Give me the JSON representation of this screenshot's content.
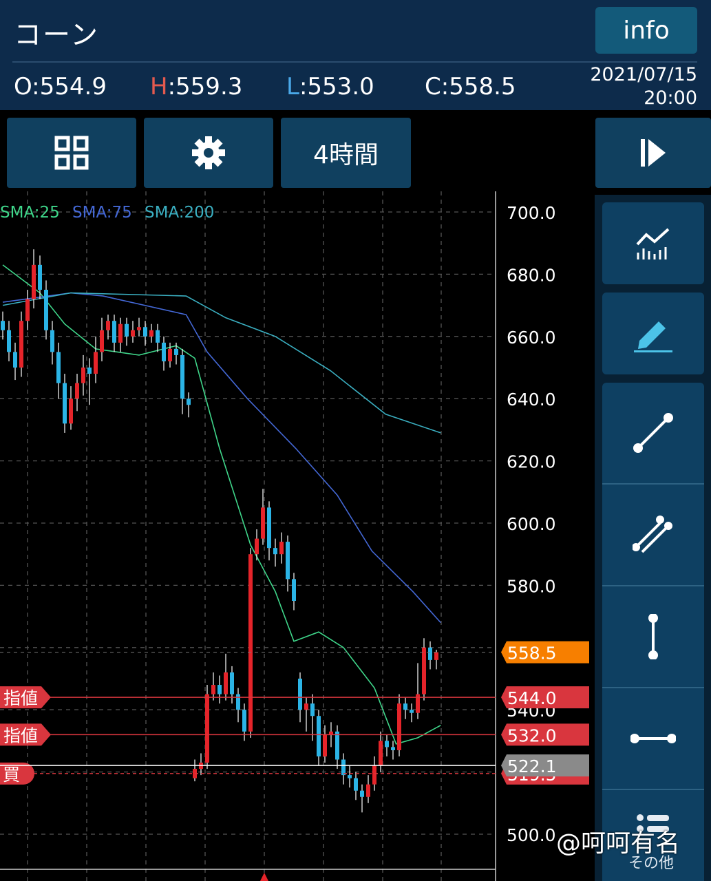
{
  "header": {
    "title": "コーン",
    "info_label": "info",
    "open": {
      "key": "O",
      "value": "554.9"
    },
    "high": {
      "key": "H",
      "value": "559.3"
    },
    "low": {
      "key": "L",
      "value": "553.0"
    },
    "close": {
      "key": "C",
      "value": "558.5"
    },
    "date": "2021/07/15",
    "time": "20:00"
  },
  "toolbar": {
    "layout_icon": "grid-icon",
    "settings_icon": "gear-icon",
    "timeframe_label": "4時間",
    "play_icon": "step-forward-icon"
  },
  "sidebar": {
    "tools": [
      "indicator-chart-icon",
      "pencil-icon",
      "trendline-icon",
      "parallel-lines-icon",
      "vertical-line-icon",
      "horizontal-line-icon",
      "menu-icon"
    ],
    "other_label": "その他"
  },
  "watermark": "@呵呵有名",
  "chart_data": {
    "type": "candlestick",
    "legend": [
      "SMA:25",
      "SMA:75",
      "SMA:200"
    ],
    "colors": {
      "up": "#e5242a",
      "down": "#2bb4e6",
      "sma25": "#3fd68a",
      "sma75": "#4468d6",
      "sma200": "#3aaec0",
      "current": "#f77f00",
      "order": "#d9363e",
      "position": "#8a8a8a"
    },
    "ylim": [
      490,
      710
    ],
    "y_ticks": [
      "700.0",
      "680.0",
      "660.0",
      "640.0",
      "620.0",
      "600.0",
      "580.0",
      "560.0",
      "540.0",
      "520.0",
      "500.0"
    ],
    "candles": [
      [
        665,
        668,
        659,
        662
      ],
      [
        662,
        665,
        652,
        655
      ],
      [
        655,
        658,
        646,
        650
      ],
      [
        650,
        668,
        647,
        665
      ],
      [
        665,
        675,
        662,
        672
      ],
      [
        672,
        688,
        669,
        683
      ],
      [
        683,
        686,
        672,
        675
      ],
      [
        675,
        678,
        659,
        662
      ],
      [
        662,
        665,
        651,
        655
      ],
      [
        655,
        658,
        640,
        645
      ],
      [
        645,
        648,
        629,
        632
      ],
      [
        632,
        644,
        630,
        640
      ],
      [
        640,
        648,
        636,
        645
      ],
      [
        645,
        654,
        641,
        650
      ],
      [
        650,
        653,
        638,
        648
      ],
      [
        648,
        660,
        645,
        655
      ],
      [
        655,
        666,
        652,
        662
      ],
      [
        662,
        667,
        659,
        665
      ],
      [
        665,
        667,
        655,
        658
      ],
      [
        658,
        666,
        655,
        664
      ],
      [
        664,
        666,
        657,
        660
      ],
      [
        660,
        665,
        658,
        662
      ],
      [
        662,
        666,
        660,
        663
      ],
      [
        663,
        665,
        657,
        660
      ],
      [
        660,
        664,
        658,
        662
      ],
      [
        662,
        664,
        655,
        658
      ],
      [
        658,
        660,
        649,
        652
      ],
      [
        652,
        658,
        650,
        656
      ],
      [
        656,
        658,
        651,
        654
      ],
      [
        654,
        656,
        635,
        640
      ],
      [
        640,
        642,
        634,
        638
      ],
      [
        518,
        524,
        517,
        521
      ],
      [
        521,
        526,
        519,
        523
      ],
      [
        523,
        548,
        521,
        545
      ],
      [
        545,
        552,
        543,
        548
      ],
      [
        548,
        551,
        542,
        545
      ],
      [
        545,
        558,
        543,
        552
      ],
      [
        552,
        554,
        542,
        545
      ],
      [
        545,
        547,
        536,
        540
      ],
      [
        540,
        542,
        530,
        533
      ],
      [
        533,
        592,
        531,
        590
      ],
      [
        590,
        598,
        588,
        595
      ],
      [
        595,
        611,
        593,
        605
      ],
      [
        605,
        607,
        588,
        592
      ],
      [
        592,
        595,
        586,
        590
      ],
      [
        590,
        597,
        587,
        594
      ],
      [
        594,
        596,
        578,
        582
      ],
      [
        582,
        584,
        572,
        575
      ],
      [
        550,
        552,
        536,
        540
      ],
      [
        540,
        544,
        533,
        542
      ],
      [
        542,
        545,
        530,
        538
      ],
      [
        538,
        540,
        522,
        525
      ],
      [
        525,
        535,
        523,
        532
      ],
      [
        532,
        536,
        528,
        533
      ],
      [
        533,
        535,
        521,
        524
      ],
      [
        524,
        526,
        516,
        519
      ],
      [
        519,
        522,
        515,
        518
      ],
      [
        518,
        520,
        511,
        514
      ],
      [
        514,
        516,
        507,
        512
      ],
      [
        512,
        519,
        510,
        516
      ],
      [
        516,
        525,
        514,
        522
      ],
      [
        522,
        533,
        520,
        530
      ],
      [
        530,
        532,
        525,
        528
      ],
      [
        528,
        530,
        524,
        527
      ],
      [
        527,
        545,
        525,
        542
      ],
      [
        542,
        544,
        537,
        540
      ],
      [
        540,
        542,
        536,
        539
      ],
      [
        539,
        555,
        537,
        545
      ],
      [
        545,
        563,
        543,
        560
      ],
      [
        560,
        562,
        553,
        556
      ],
      [
        556,
        559.3,
        553,
        558.5
      ]
    ],
    "sma25": [
      [
        0,
        683
      ],
      [
        6,
        674
      ],
      [
        10,
        664
      ],
      [
        15,
        656
      ],
      [
        22,
        654
      ],
      [
        28,
        657
      ],
      [
        31,
        653
      ],
      [
        35,
        624
      ],
      [
        40,
        593
      ],
      [
        44,
        578
      ],
      [
        47,
        562
      ],
      [
        51,
        565
      ],
      [
        55,
        560
      ],
      [
        60,
        547
      ],
      [
        63.5,
        529
      ],
      [
        67,
        531
      ],
      [
        70.7,
        535
      ]
    ],
    "sma75": [
      [
        0,
        671
      ],
      [
        11,
        674
      ],
      [
        16.2,
        673
      ],
      [
        29.6,
        667
      ],
      [
        33,
        655
      ],
      [
        39.5,
        640
      ],
      [
        47.3,
        624
      ],
      [
        54,
        609
      ],
      [
        59.6,
        591
      ],
      [
        66.2,
        578
      ],
      [
        70.7,
        568
      ]
    ],
    "sma200": [
      [
        0,
        670
      ],
      [
        11,
        674
      ],
      [
        29.6,
        673
      ],
      [
        36,
        666
      ],
      [
        44,
        660
      ],
      [
        52.9,
        649
      ],
      [
        61.8,
        635
      ],
      [
        70.7,
        629
      ]
    ],
    "current_price": {
      "value": 558.5,
      "label": "558.5"
    },
    "orders": [
      {
        "type": "指値",
        "value": 544.0,
        "label": "544.0"
      },
      {
        "type": "指値",
        "value": 532.0,
        "label": "532.0"
      }
    ],
    "position": {
      "type": "買",
      "value": 519.5,
      "label": "519.5"
    },
    "marker": {
      "value": 522.1,
      "label": "522.1"
    }
  }
}
